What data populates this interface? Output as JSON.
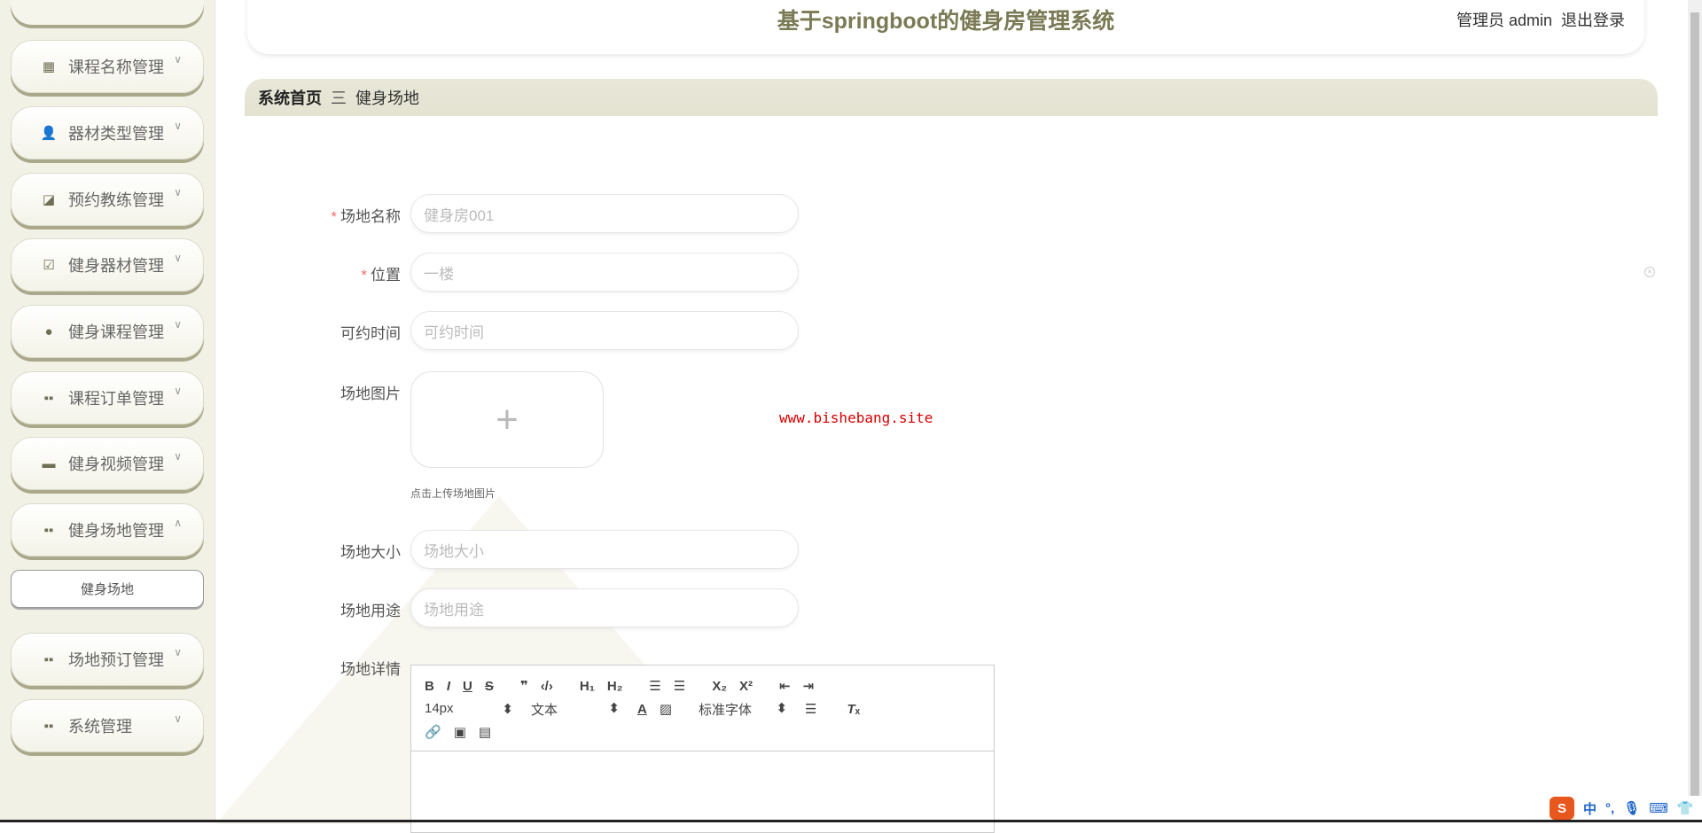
{
  "header": {
    "title": "基于springboot的健身房管理系统",
    "user": "管理员 admin",
    "logout": "退出登录"
  },
  "breadcrumb": {
    "home": "系统首页",
    "separator": "三",
    "current": "健身场地"
  },
  "sidebar": {
    "items": [
      {
        "label": "课程名称管理",
        "icon": "grid-icon"
      },
      {
        "label": "器材类型管理",
        "icon": "user-icon"
      },
      {
        "label": "预约教练管理",
        "icon": "chart-icon"
      },
      {
        "label": "健身器材管理",
        "icon": "clipboard-check-icon"
      },
      {
        "label": "健身课程管理",
        "icon": "bulb-icon"
      },
      {
        "label": "课程订单管理",
        "icon": "grid-icon"
      },
      {
        "label": "健身视频管理",
        "icon": "box-icon"
      },
      {
        "label": "健身场地管理",
        "icon": "grid-icon",
        "expanded": true
      },
      {
        "label": "场地预订管理",
        "icon": "grid-icon"
      },
      {
        "label": "系统管理",
        "icon": "grid-icon"
      }
    ],
    "sub_item": "健身场地"
  },
  "form": {
    "name": {
      "label": "场地名称",
      "placeholder": "健身房001",
      "required": true
    },
    "location": {
      "label": "位置",
      "placeholder": "一楼",
      "required": true
    },
    "time": {
      "label": "可约时间",
      "placeholder": "可约时间"
    },
    "image": {
      "label": "场地图片",
      "hint": "点击上传场地图片"
    },
    "size": {
      "label": "场地大小",
      "placeholder": "场地大小"
    },
    "usage": {
      "label": "场地用途",
      "placeholder": "场地用途"
    },
    "detail": {
      "label": "场地详情",
      "font_size": "14px",
      "header": "文本",
      "font": "标准字体"
    }
  },
  "watermark": "www.bishebang.site",
  "ime": {
    "lang": "中",
    "punct": "°,"
  }
}
